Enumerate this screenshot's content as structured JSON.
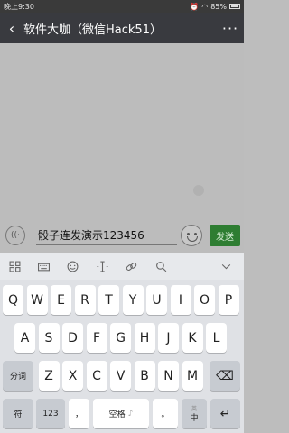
{
  "status_bar": {
    "time": "晚上9:30",
    "battery": "85%"
  },
  "header": {
    "back_icon": "‹",
    "title": "软件大咖（微信Hack51）",
    "more_icon": "···"
  },
  "input_bar": {
    "message_text": "骰子连发演示123456",
    "send_label": "发送"
  },
  "keyboard": {
    "row1": [
      "Q",
      "W",
      "E",
      "R",
      "T",
      "Y",
      "U",
      "I",
      "O",
      "P"
    ],
    "row2": [
      "A",
      "S",
      "D",
      "F",
      "G",
      "H",
      "J",
      "K",
      "L"
    ],
    "segment_label": "分词",
    "row3": [
      "Z",
      "X",
      "C",
      "V",
      "B",
      "N",
      "M"
    ],
    "backspace_icon": "⌫",
    "symbols_label": "符",
    "numbers_label": "123",
    "comma_label": "，",
    "space_label": "空格",
    "period_label": "。",
    "lang_top": "英",
    "lang_bottom": "中",
    "enter_icon": "↵"
  }
}
